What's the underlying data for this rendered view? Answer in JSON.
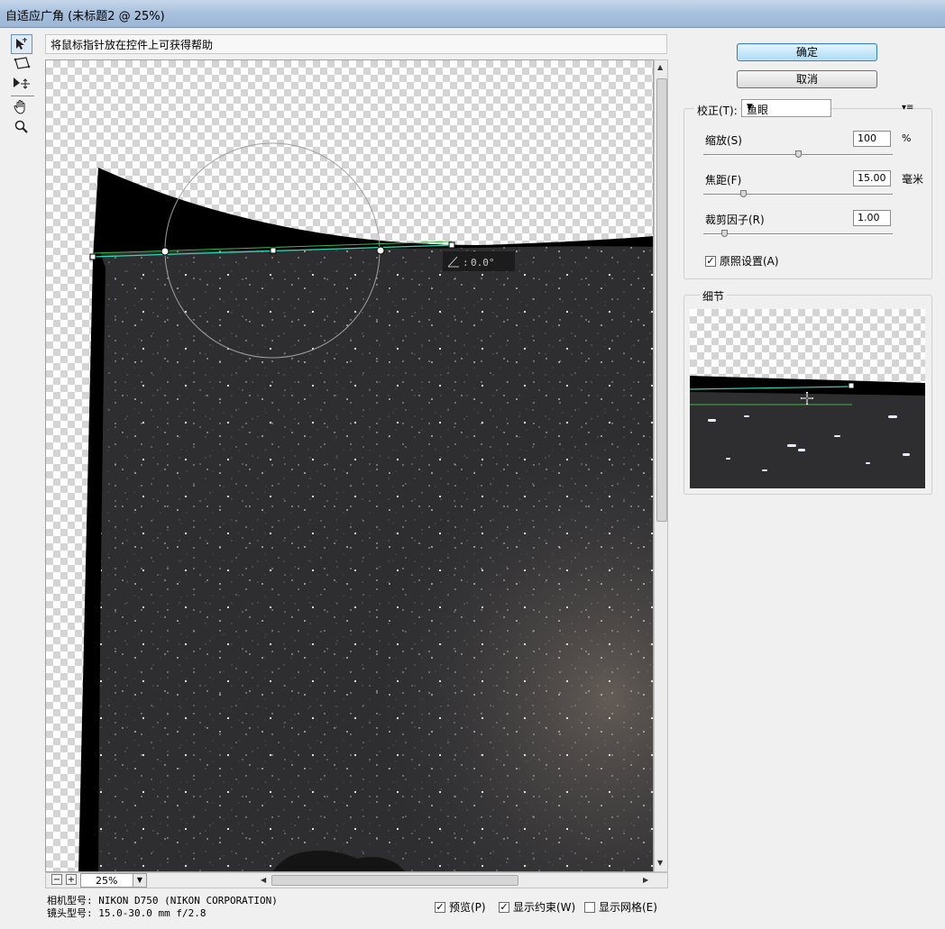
{
  "window": {
    "title": "自适应广角 (未标题2 @ 25%)"
  },
  "hint": "将鼠标指针放在控件上可获得帮助",
  "tools": [
    "constraint-tool-icon",
    "polygon-constraint-tool-icon",
    "move-tool-icon",
    "hand-tool-icon",
    "zoom-tool-icon"
  ],
  "angle_readout": "0.0°",
  "zoom": {
    "minus": "−",
    "plus": "+",
    "value": "25%"
  },
  "camera_info": {
    "camera": "相机型号: NIKON D750 (NIKON CORPORATION)",
    "lens": "镜头型号: 15.0-30.0 mm f/2.8"
  },
  "options": [
    {
      "label": "预览(P)",
      "checked": true
    },
    {
      "label": "显示约束(W)",
      "checked": true
    },
    {
      "label": "显示网格(E)",
      "checked": false
    }
  ],
  "buttons": {
    "ok": "确定",
    "cancel": "取消"
  },
  "correction": {
    "label": "校正(T):",
    "selected": "鱼眼",
    "params": [
      {
        "label": "缩放(S)",
        "value": "100",
        "unit": "%",
        "position": 0.5
      },
      {
        "label": "焦距(F)",
        "value": "15.00",
        "unit": "毫米",
        "position": 0.2
      },
      {
        "label": "裁剪因子(R)",
        "value": "1.00",
        "unit": "",
        "position": 0.1
      }
    ],
    "as_shot": {
      "label": "原照设置(A)",
      "checked": true
    }
  },
  "detail": {
    "label": "细节"
  },
  "colors": {
    "sky": "#2e2e30",
    "constraint": "#2fd6b6",
    "accent": "#a9dbf6"
  }
}
